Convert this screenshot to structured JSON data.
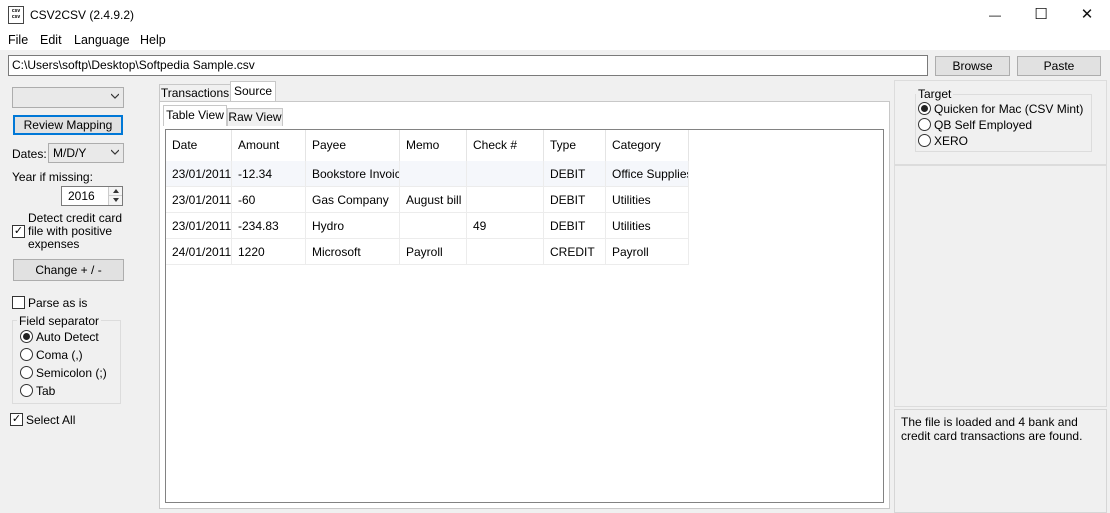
{
  "window": {
    "icon_text": "csv\ncsv",
    "title": "CSV2CSV (2.4.9.2)",
    "minimize_glyph": "—",
    "maximize_glyph": "☐",
    "close_glyph": "✕"
  },
  "menu": [
    "File",
    "Edit",
    "Language",
    "Help"
  ],
  "path": {
    "value": "C:\\Users\\softp\\Desktop\\Softpedia Sample.csv",
    "browse_label": "Browse",
    "paste_label": "Paste"
  },
  "left": {
    "mapping_combo_value": "",
    "review_mapping_label": "Review Mapping",
    "dates_label": "Dates:",
    "dates_value": "M/D/Y",
    "year_missing_label": "Year if missing:",
    "year_value": "2016",
    "detect_cc_label": "Detect credit card file with positive expenses",
    "detect_cc_checked": true,
    "change_sign_label": "Change + / -",
    "parse_as_is_label": "Parse as is",
    "parse_as_is_checked": false,
    "field_separator_title": "Field separator",
    "separators": [
      {
        "label": "Auto Detect",
        "selected": true
      },
      {
        "label": "Coma (,)",
        "selected": false
      },
      {
        "label": "Semicolon (;)",
        "selected": false
      },
      {
        "label": "Tab",
        "selected": false
      }
    ],
    "select_all_label": "Select All",
    "select_all_checked": true
  },
  "tabs": {
    "outer": [
      "Transactions",
      "Source"
    ],
    "outer_active": "Source",
    "inner": [
      "Table View",
      "Raw View"
    ],
    "inner_active": "Table View"
  },
  "table": {
    "headers": [
      "Date",
      "Amount",
      "Payee",
      "Memo",
      "Check #",
      "Type",
      "Category"
    ],
    "rows": [
      [
        "23/01/2011",
        "-12.34",
        "Bookstore Invoice",
        "",
        "",
        "DEBIT",
        "Office Supplies"
      ],
      [
        "23/01/2011",
        "-60",
        "Gas Company",
        "August bill",
        "",
        "DEBIT",
        "Utilities"
      ],
      [
        "23/01/2011",
        "-234.83",
        "Hydro",
        "",
        "49",
        "DEBIT",
        "Utilities"
      ],
      [
        "24/01/2011",
        "1220",
        "Microsoft",
        "Payroll",
        "",
        "CREDIT",
        "Payroll"
      ]
    ]
  },
  "target": {
    "title": "Target",
    "options": [
      {
        "label": "Quicken for Mac (CSV Mint)",
        "selected": true
      },
      {
        "label": "QB Self Employed",
        "selected": false
      },
      {
        "label": "XERO",
        "selected": false
      }
    ]
  },
  "status": {
    "message": "The file is loaded and 4 bank and credit card transactions are found."
  },
  "colors": {
    "window_bg": "#f0f0f0",
    "button_face": "#e1e1e1",
    "focus_border": "#0078d7"
  }
}
